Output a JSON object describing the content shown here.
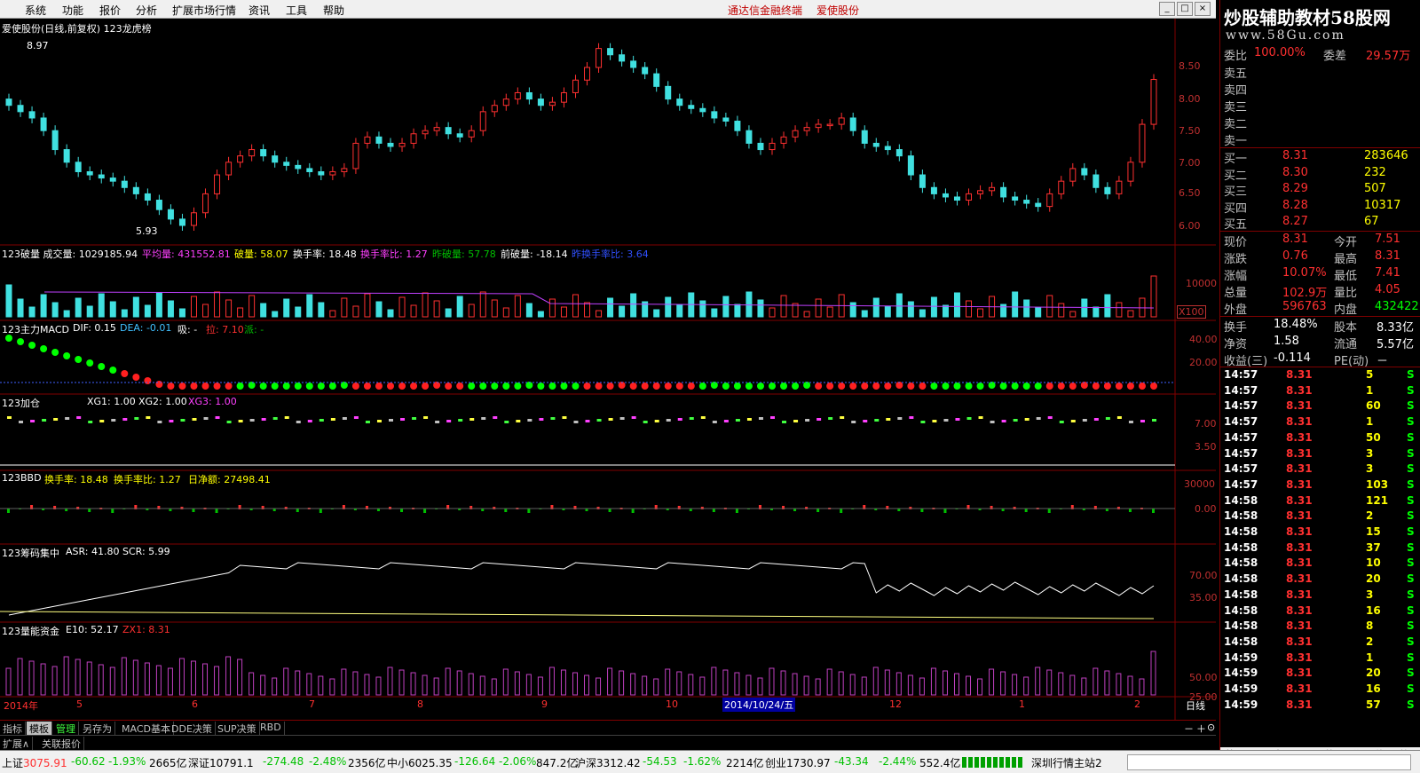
{
  "menu": {
    "items": [
      "系统",
      "功能",
      "报价",
      "分析",
      "扩展市场行情",
      "资讯",
      "工具",
      "帮助"
    ],
    "app_name": "通达信金融终端",
    "stock_name": "爱使股份"
  },
  "brand": {
    "title": "炒股辅助教材58股网",
    "url": "www.58Gu.com"
  },
  "chart": {
    "header": "爱使股份(日线,前复权) 123龙虎榜",
    "high_label": "8.97",
    "low_label": "5.93",
    "price_axis": [
      "8.50",
      "8.00",
      "7.50",
      "7.00",
      "6.50",
      "6.00"
    ],
    "closes": [
      7.9,
      7.8,
      7.7,
      7.5,
      7.2,
      7.0,
      6.85,
      6.8,
      6.75,
      6.7,
      6.6,
      6.5,
      6.4,
      6.25,
      6.1,
      6.0,
      6.2,
      6.5,
      6.8,
      7.0,
      7.1,
      7.2,
      7.1,
      7.0,
      6.95,
      6.9,
      6.85,
      6.8,
      6.85,
      6.9,
      7.3,
      7.4,
      7.3,
      7.25,
      7.3,
      7.45,
      7.5,
      7.55,
      7.45,
      7.4,
      7.5,
      7.8,
      7.9,
      8.0,
      8.1,
      8.0,
      7.9,
      7.95,
      8.1,
      8.3,
      8.5,
      8.8,
      8.7,
      8.6,
      8.5,
      8.4,
      8.2,
      8.0,
      7.9,
      7.85,
      7.8,
      7.7,
      7.65,
      7.5,
      7.3,
      7.2,
      7.3,
      7.4,
      7.5,
      7.55,
      7.6,
      7.6,
      7.7,
      7.5,
      7.3,
      7.25,
      7.2,
      7.1,
      6.8,
      6.6,
      6.5,
      6.45,
      6.4,
      6.5,
      6.55,
      6.6,
      6.45,
      6.4,
      6.35,
      6.3,
      6.5,
      6.7,
      6.9,
      6.8,
      6.6,
      6.5,
      6.7,
      7.0,
      7.6,
      8.31
    ],
    "vol_header": "123破量 成交量: 1029185.94",
    "vol_ma": "平均量: 431552.81",
    "vol_break": "破量: 58.07",
    "turnover": "换手率: 18.48",
    "turnover_ratio": "换手率比: 1.27",
    "yesterday_break": "昨破量: 57.78",
    "prev_break": "前破量: -18.14",
    "prev_turnover_ratio": "昨换手率比: 3.64",
    "vol_axis": [
      "10000",
      "X100"
    ],
    "macd_header": "123主力MACD",
    "macd_dif": "DIF: 0.15",
    "macd_dea": "DEA: -0.01",
    "macd_xi": "吸: -",
    "macd_la": "拉: 7.10",
    "macd_pai": "派: -",
    "macd_axis": [
      "40.00",
      "20.00"
    ],
    "jc_header": "123加仓",
    "jc_xg1": "XG1: 1.00",
    "jc_xg2": "XG2: 1.00",
    "jc_xg3": "XG3: 1.00",
    "jc_axis": [
      "7.00",
      "3.50"
    ],
    "bbd_header": "123BBD",
    "bbd_turnover": "换手率: 18.48",
    "bbd_ratio": "换手率比: 1.27",
    "bbd_net": "日净额: 27498.41",
    "bbd_axis": [
      "30000",
      "0.00"
    ],
    "cm_header": "123筹码集中",
    "cm_asr": "ASR: 41.80",
    "cm_scr": "SCR: 5.99",
    "cm_axis": [
      "70.00",
      "35.00"
    ],
    "ln_header": "123量能资金",
    "ln_e10": "E10: 52.17",
    "ln_zx1": "ZX1: 8.31",
    "ln_axis": [
      "50.00",
      "25.00"
    ],
    "date_axis": [
      "2014年",
      "5",
      "6",
      "7",
      "8",
      "9",
      "10",
      "12",
      "1",
      "2"
    ],
    "highlight_date": "2014/10/24/五",
    "period": "日线"
  },
  "bottom_tabs": [
    "指标",
    "模板",
    "管理",
    "另存为",
    "MACD基本",
    "DDE决策",
    "SUP决策",
    "RBD"
  ],
  "bottom_tabs2": [
    "扩展∧",
    "关联报价"
  ],
  "quote": {
    "weibi_label": "委比",
    "weibi_value": "100.00%",
    "weicha_label": "委差",
    "weicha_value": "29.57万",
    "sell": [
      {
        "label": "卖五",
        "price": "",
        "vol": ""
      },
      {
        "label": "卖四",
        "price": "",
        "vol": ""
      },
      {
        "label": "卖三",
        "price": "",
        "vol": ""
      },
      {
        "label": "卖二",
        "price": "",
        "vol": ""
      },
      {
        "label": "卖一",
        "price": "",
        "vol": ""
      }
    ],
    "buy": [
      {
        "label": "买一",
        "price": "8.31",
        "vol": "283646"
      },
      {
        "label": "买二",
        "price": "8.30",
        "vol": "232"
      },
      {
        "label": "买三",
        "price": "8.29",
        "vol": "507"
      },
      {
        "label": "买四",
        "price": "8.28",
        "vol": "10317"
      },
      {
        "label": "买五",
        "price": "8.27",
        "vol": "67"
      }
    ],
    "stats": [
      {
        "l1": "现价",
        "v1": "8.31",
        "l2": "今开",
        "v2": "7.51"
      },
      {
        "l1": "涨跌",
        "v1": "0.76",
        "l2": "最高",
        "v2": "8.31"
      },
      {
        "l1": "涨幅",
        "v1": "10.07%",
        "l2": "最低",
        "v2": "7.41"
      },
      {
        "l1": "总量",
        "v1": "102.9万",
        "l2": "量比",
        "v2": "4.05"
      },
      {
        "l1": "外盘",
        "v1": "596763",
        "l2": "内盘",
        "v2": "432422"
      }
    ],
    "stats2": [
      {
        "l1": "换手",
        "v1": "18.48%",
        "l2": "股本",
        "v2": "8.33亿"
      },
      {
        "l1": "净资",
        "v1": "1.58",
        "l2": "流通",
        "v2": "5.57亿"
      },
      {
        "l1": "收益(三)",
        "v1": "-0.114",
        "l2": "PE(动)",
        "v2": "－"
      }
    ],
    "ticks": [
      {
        "t": "14:57",
        "p": "8.31",
        "v": "5",
        "s": "S"
      },
      {
        "t": "14:57",
        "p": "8.31",
        "v": "1",
        "s": "S"
      },
      {
        "t": "14:57",
        "p": "8.31",
        "v": "60",
        "s": "S"
      },
      {
        "t": "14:57",
        "p": "8.31",
        "v": "1",
        "s": "S"
      },
      {
        "t": "14:57",
        "p": "8.31",
        "v": "50",
        "s": "S"
      },
      {
        "t": "14:57",
        "p": "8.31",
        "v": "3",
        "s": "S"
      },
      {
        "t": "14:57",
        "p": "8.31",
        "v": "3",
        "s": "S"
      },
      {
        "t": "14:57",
        "p": "8.31",
        "v": "103",
        "s": "S"
      },
      {
        "t": "14:58",
        "p": "8.31",
        "v": "121",
        "s": "S"
      },
      {
        "t": "14:58",
        "p": "8.31",
        "v": "2",
        "s": "S"
      },
      {
        "t": "14:58",
        "p": "8.31",
        "v": "15",
        "s": "S"
      },
      {
        "t": "14:58",
        "p": "8.31",
        "v": "37",
        "s": "S"
      },
      {
        "t": "14:58",
        "p": "8.31",
        "v": "10",
        "s": "S"
      },
      {
        "t": "14:58",
        "p": "8.31",
        "v": "20",
        "s": "S"
      },
      {
        "t": "14:58",
        "p": "8.31",
        "v": "3",
        "s": "S"
      },
      {
        "t": "14:58",
        "p": "8.31",
        "v": "16",
        "s": "S"
      },
      {
        "t": "14:58",
        "p": "8.31",
        "v": "8",
        "s": "S"
      },
      {
        "t": "14:58",
        "p": "8.31",
        "v": "2",
        "s": "S"
      },
      {
        "t": "14:59",
        "p": "8.31",
        "v": "1",
        "s": "S"
      },
      {
        "t": "14:59",
        "p": "8.31",
        "v": "20",
        "s": "S"
      },
      {
        "t": "14:59",
        "p": "8.31",
        "v": "16",
        "s": "S"
      },
      {
        "t": "14:59",
        "p": "8.31",
        "v": "57",
        "s": "S"
      }
    ],
    "side_tabs": [
      "笔",
      "价",
      "细",
      "日",
      "势",
      "联",
      "值",
      "筹"
    ]
  },
  "status": {
    "sh_label": "上证",
    "sh_value": "3075.91",
    "sh_chg": "-60.62",
    "sh_pct": "-1.93%",
    "sh_amt": "2665亿",
    "sz_label": "深证",
    "sz_value": "10791.1",
    "sz_chg": "-274.48",
    "sz_pct": "-2.48%",
    "sz_amt": "2356亿",
    "zx_label": "中小",
    "zx_value": "6025.35",
    "zx_chg": "-126.64",
    "zx_pct": "-2.06%",
    "zx_amt": "847.2亿",
    "hs_label": "沪深",
    "hs_value": "3312.42",
    "hs_chg": "-54.53",
    "hs_pct": "-1.62%",
    "hs_amt": "2214亿",
    "cy_label": "创业",
    "cy_value": "1730.97",
    "cy_chg": "-43.34",
    "cy_pct": "-2.44%",
    "cy_amt": "552.4亿",
    "server": "深圳行情主站2"
  }
}
